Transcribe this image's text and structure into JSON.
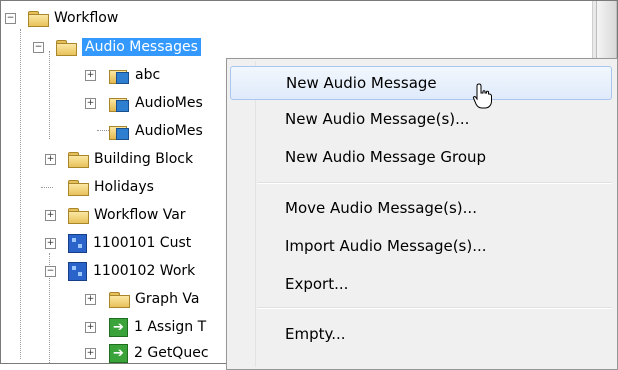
{
  "tree": {
    "items": [
      {
        "label": "Workflow",
        "icon": "folder-icon",
        "expander": "−"
      },
      {
        "label": "Audio Messages",
        "icon": "folder-icon",
        "expander": "−",
        "selected": true
      },
      {
        "label": "abc",
        "icon": "audio-message-icon",
        "expander": "+"
      },
      {
        "label": "AudioMes",
        "icon": "audio-message-icon",
        "expander": "+"
      },
      {
        "label": "AudioMes",
        "icon": "audio-message-icon",
        "expander": ""
      },
      {
        "label": "Building Block",
        "icon": "folder-icon",
        "expander": "+"
      },
      {
        "label": "Holidays",
        "icon": "folder-icon",
        "expander": ""
      },
      {
        "label": "Workflow Var",
        "icon": "folder-icon",
        "expander": "+"
      },
      {
        "label": "1100101 Cust",
        "icon": "workflow-icon",
        "expander": "+"
      },
      {
        "label": "1100102 Work",
        "icon": "workflow-icon",
        "expander": "−"
      },
      {
        "label": "Graph Va",
        "icon": "folder-icon",
        "expander": "+"
      },
      {
        "label": "1 Assign T",
        "icon": "step-arrow-icon",
        "expander": "+"
      },
      {
        "label": "2 GetQuec",
        "icon": "step-arrow-icon",
        "expander": "+"
      }
    ]
  },
  "context_menu": {
    "items": [
      {
        "label": "New Audio Message",
        "hover": true
      },
      {
        "label": "New Audio Message(s)..."
      },
      {
        "label": "New Audio Message Group"
      },
      {
        "label": "Move Audio Message(s)..."
      },
      {
        "label": "Import Audio Message(s)..."
      },
      {
        "label": "Export..."
      },
      {
        "label": "Empty..."
      }
    ]
  },
  "colors": {
    "selection": "#3399ff",
    "menu_background": "#f0f0f0",
    "menu_hover": "#dfeafa"
  }
}
